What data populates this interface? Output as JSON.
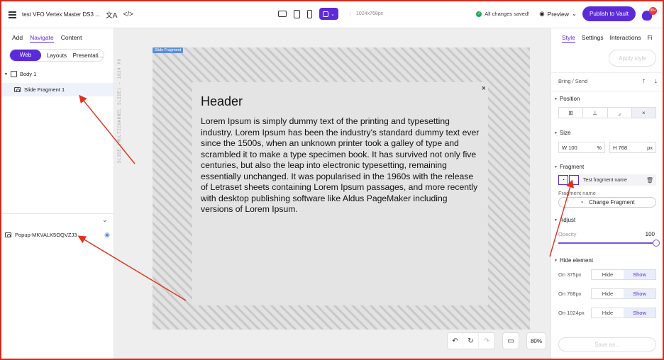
{
  "topbar": {
    "project_title": "test VFO Vertex Master DS3 ...",
    "resolution": "1024x768px",
    "saved_status": "All changes saved!",
    "preview_label": "Preview",
    "publish_label": "Publish to Vault",
    "notif_count": "99+"
  },
  "left_panel": {
    "tabs": [
      "Add",
      "Navigate",
      "Content"
    ],
    "segments": [
      "Web",
      "Layouts",
      "Presentati..."
    ],
    "tree": {
      "body": "Body 1",
      "fragment": "Slide Fragment 1"
    },
    "popup_name": "Popup-MKVALK5OQVZJ3"
  },
  "canvas": {
    "ruler_text": "SLIDE (MULTICHANNEL SLIDE) - 1024 PX",
    "slide_label": "Slide Fragment",
    "popup_close": "×",
    "popup_header": "Header",
    "popup_body": "Lorem Ipsum is simply dummy text of the printing and typesetting industry. Lorem Ipsum has been the industry's standard dummy text ever since the 1500s, when an unknown printer took a galley of type and scrambled it to make a type specimen book. It has survived not only five centuries, but also the leap into electronic typesetting, remaining essentially unchanged. It was popularised in the 1960s with the release of Letraset sheets containing Lorem Ipsum passages, and more recently with desktop publishing software like Aldus PageMaker including versions of Lorem Ipsum.",
    "zoom": "80%"
  },
  "right_panel": {
    "tabs": [
      "Style",
      "Settings",
      "Interactions",
      "Fi"
    ],
    "apply_style": "Apply style",
    "bring_send": "Bring / Send",
    "position_title": "Position",
    "size_title": "Size",
    "size_w_label": "W",
    "size_w_value": "100",
    "size_w_unit": "%",
    "size_h_label": "H",
    "size_h_value": "768",
    "size_h_unit": "px",
    "fragment_title": "Fragment",
    "fragment_name": "Test fragment name",
    "fragment_name_label": "Fragment name",
    "change_fragment": "Change Fragment",
    "adjust_title": "Adjust",
    "opacity_label": "Opacity",
    "opacity_value": "100",
    "opacity_fraction": 1.0,
    "hide_title": "Hide element",
    "hide_rows": [
      {
        "label": "On 375px",
        "hide": "Hide",
        "show": "Show"
      },
      {
        "label": "On 768px",
        "hide": "Hide",
        "show": "Show"
      },
      {
        "label": "On 1024px",
        "hide": "Hide",
        "show": "Show"
      }
    ],
    "save_as": "Save as..."
  },
  "colors": {
    "accent": "#5b2bd8",
    "annotation": "#e0301e",
    "frame": "#d42a1f"
  }
}
